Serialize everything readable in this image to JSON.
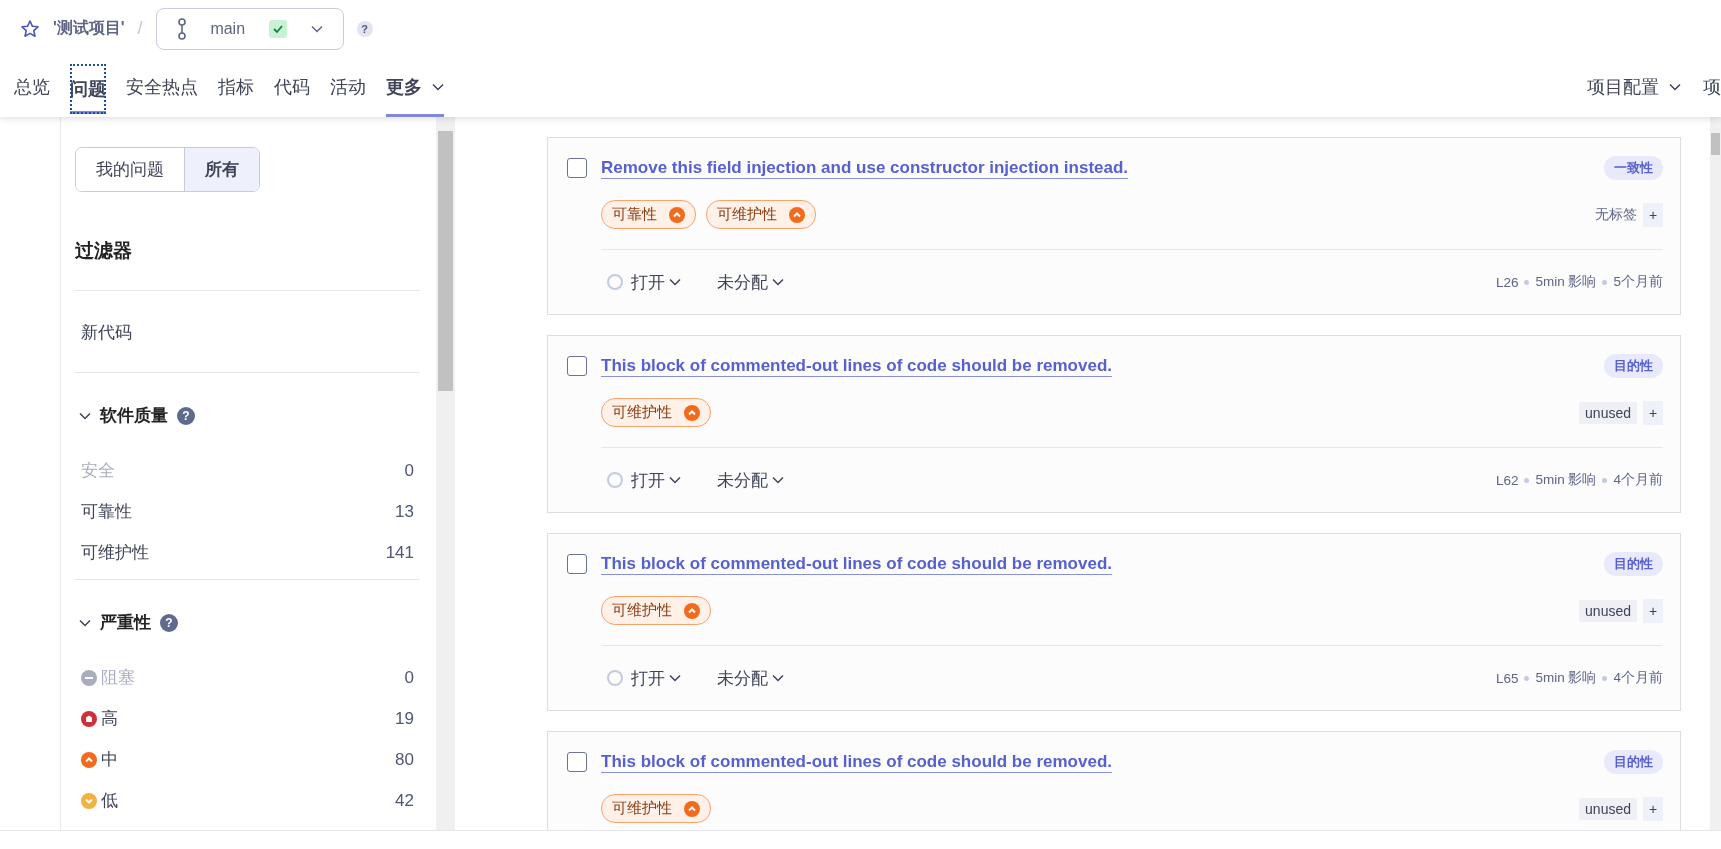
{
  "project": {
    "name": "'测试项目'",
    "separator": "/",
    "branch": "main",
    "branch_ok": true,
    "help": "?"
  },
  "nav": {
    "tabs": [
      {
        "label": "总览",
        "selected": false,
        "focused": false,
        "caret": false
      },
      {
        "label": "问题",
        "selected": true,
        "focused": true,
        "caret": false
      },
      {
        "label": "安全热点",
        "selected": false,
        "focused": false,
        "caret": false
      },
      {
        "label": "指标",
        "selected": false,
        "focused": false,
        "caret": false
      },
      {
        "label": "代码",
        "selected": false,
        "focused": false,
        "caret": false
      },
      {
        "label": "活动",
        "selected": false,
        "focused": false,
        "caret": false
      },
      {
        "label": "更多",
        "selected": true,
        "focused": false,
        "caret": true
      }
    ],
    "right": [
      {
        "label": "项目配置",
        "caret": true
      },
      {
        "label": "项",
        "caret": false
      }
    ]
  },
  "sidebar": {
    "toggle": [
      {
        "label": "我的问题",
        "selected": false
      },
      {
        "label": "所有",
        "selected": true
      }
    ],
    "title": "过滤器",
    "new_code": "新代码",
    "sections": [
      {
        "title": "软件质量",
        "expanded": true,
        "help": "?",
        "items": [
          {
            "label": "安全",
            "count": "0",
            "disabled": true
          },
          {
            "label": "可靠性",
            "count": "13",
            "disabled": false
          },
          {
            "label": "可维护性",
            "count": "141",
            "disabled": false
          }
        ]
      },
      {
        "title": "严重性",
        "expanded": true,
        "help": "?",
        "items": [
          {
            "label": "阻塞",
            "count": "0",
            "disabled": true,
            "kind": "blocker"
          },
          {
            "label": "高",
            "count": "19",
            "disabled": false,
            "kind": "high"
          },
          {
            "label": "中",
            "count": "80",
            "disabled": false,
            "kind": "medium"
          },
          {
            "label": "低",
            "count": "42",
            "disabled": false,
            "kind": "low"
          }
        ]
      }
    ]
  },
  "issues": [
    {
      "checked": false,
      "title": "Remove this field injection and use constructor injection instead.",
      "attribute": "一致性",
      "qualities": [
        {
          "label": "可靠性",
          "kind": "medium"
        },
        {
          "label": "可维护性",
          "kind": "medium"
        }
      ],
      "tags": {
        "kind": "none",
        "text": "无标签"
      },
      "add": "+",
      "footer": {
        "status": "打开",
        "assignee": "未分配",
        "line": "L26",
        "effort": "5min 影响",
        "age": "5个月前"
      }
    },
    {
      "checked": false,
      "title": "This block of commented-out lines of code should be removed.",
      "attribute": "目的性",
      "qualities": [
        {
          "label": "可维护性",
          "kind": "medium"
        }
      ],
      "tags": {
        "kind": "tag",
        "text": "unused"
      },
      "add": "+",
      "footer": {
        "status": "打开",
        "assignee": "未分配",
        "line": "L62",
        "effort": "5min 影响",
        "age": "4个月前"
      }
    },
    {
      "checked": false,
      "title": "This block of commented-out lines of code should be removed.",
      "attribute": "目的性",
      "qualities": [
        {
          "label": "可维护性",
          "kind": "medium"
        }
      ],
      "tags": {
        "kind": "tag",
        "text": "unused"
      },
      "add": "+",
      "footer": {
        "status": "打开",
        "assignee": "未分配",
        "line": "L65",
        "effort": "5min 影响",
        "age": "4个月前"
      }
    },
    {
      "checked": false,
      "title": "This block of commented-out lines of code should be removed.",
      "attribute": "目的性",
      "qualities": [
        {
          "label": "可维护性",
          "kind": "medium"
        }
      ],
      "tags": {
        "kind": "tag",
        "text": "unused"
      },
      "add": "+"
    }
  ]
}
